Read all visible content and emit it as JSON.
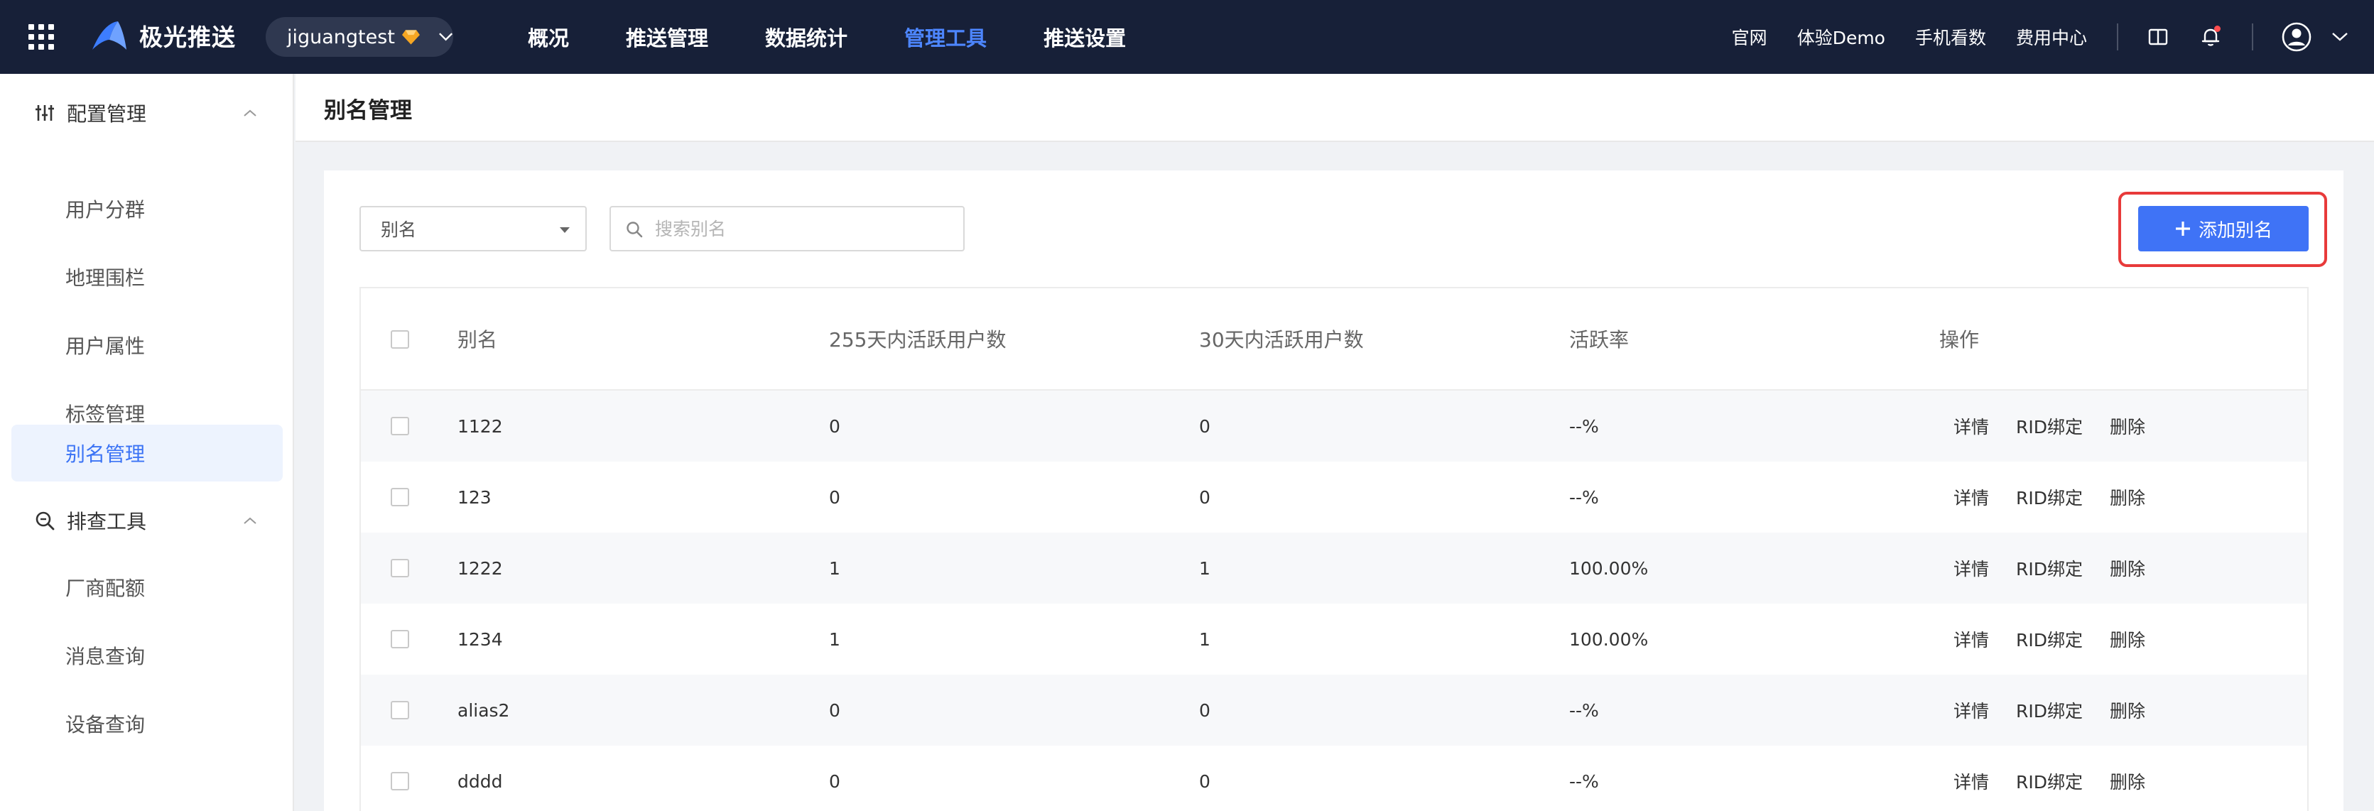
{
  "topbar": {
    "logo_text": "极光推送",
    "app_name": "jiguangtest",
    "nav": [
      "概况",
      "推送管理",
      "数据统计",
      "管理工具",
      "推送设置"
    ],
    "active_nav_index": 3,
    "links": [
      "官网",
      "体验Demo",
      "手机看数",
      "费用中心"
    ],
    "colors": {
      "bg": "#172038",
      "active": "#4d86ff"
    }
  },
  "sidebar": {
    "groups": [
      {
        "label": "配置管理",
        "icon": "sliders-icon",
        "items": [
          "用户分群",
          "地理围栏",
          "用户属性",
          "标签管理",
          "别名管理"
        ]
      },
      {
        "label": "排查工具",
        "icon": "zoom-search-icon",
        "items": [
          "厂商配额",
          "消息查询",
          "设备查询"
        ]
      }
    ],
    "active_item": "别名管理",
    "active_color": "#3b73f5"
  },
  "page": {
    "title": "别名管理",
    "filter_select": "别名",
    "search_placeholder": "搜索别名",
    "add_button_label": "添加别名",
    "accent_color": "#3f73f6",
    "highlight_color": "#e83a3a"
  },
  "table": {
    "columns": [
      "别名",
      "255天内活跃用户数",
      "30天内活跃用户数",
      "活跃率",
      "操作"
    ],
    "actions": [
      "详情",
      "RID绑定",
      "删除"
    ],
    "rows": [
      {
        "alias": "1122",
        "active255": "0",
        "active30": "0",
        "rate": "--%"
      },
      {
        "alias": "123",
        "active255": "0",
        "active30": "0",
        "rate": "--%"
      },
      {
        "alias": "1222",
        "active255": "1",
        "active30": "1",
        "rate": "100.00%"
      },
      {
        "alias": "1234",
        "active255": "1",
        "active30": "1",
        "rate": "100.00%"
      },
      {
        "alias": "alias2",
        "active255": "0",
        "active30": "0",
        "rate": "--%"
      },
      {
        "alias": "dddd",
        "active255": "0",
        "active30": "0",
        "rate": "--%"
      }
    ]
  }
}
